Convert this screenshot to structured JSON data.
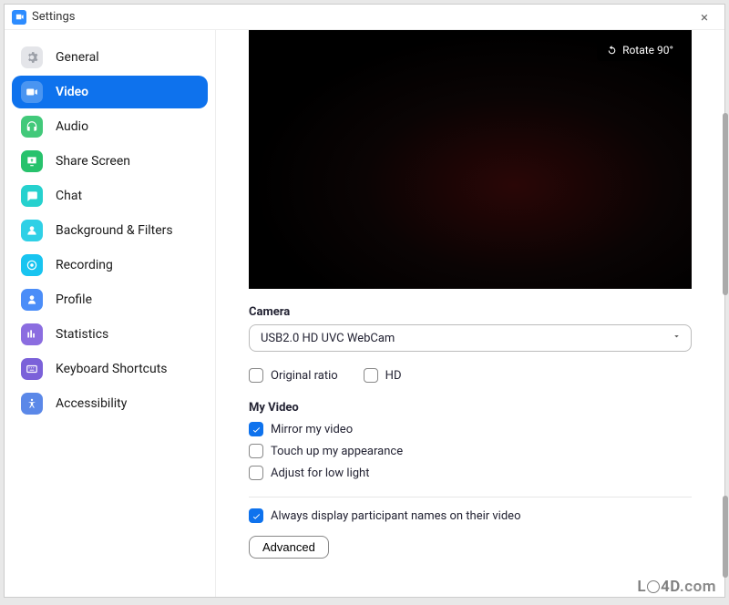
{
  "window": {
    "title": "Settings",
    "close_label": "×"
  },
  "sidebar": {
    "items": [
      {
        "label": "General",
        "icon_bg": "#E4E5E9",
        "selected": false,
        "icon": "gear"
      },
      {
        "label": "Video",
        "icon_bg": "#0E72ED",
        "selected": true,
        "icon": "video"
      },
      {
        "label": "Audio",
        "icon_bg": "#42C97A",
        "selected": false,
        "icon": "headphones"
      },
      {
        "label": "Share Screen",
        "icon_bg": "#27C26C",
        "selected": false,
        "icon": "share"
      },
      {
        "label": "Chat",
        "icon_bg": "#26D1CE",
        "selected": false,
        "icon": "chat"
      },
      {
        "label": "Background & Filters",
        "icon_bg": "#2FD0E6",
        "selected": false,
        "icon": "user"
      },
      {
        "label": "Recording",
        "icon_bg": "#18C4F0",
        "selected": false,
        "icon": "record"
      },
      {
        "label": "Profile",
        "icon_bg": "#4B8DF8",
        "selected": false,
        "icon": "profile"
      },
      {
        "label": "Statistics",
        "icon_bg": "#8B6DE0",
        "selected": false,
        "icon": "stats"
      },
      {
        "label": "Keyboard Shortcuts",
        "icon_bg": "#7B61D9",
        "selected": false,
        "icon": "keyboard"
      },
      {
        "label": "Accessibility",
        "icon_bg": "#5B88E8",
        "selected": false,
        "icon": "accessibility"
      }
    ]
  },
  "content": {
    "rotate_label": "Rotate 90°",
    "camera_heading": "Camera",
    "camera_selected": "USB2.0 HD UVC WebCam",
    "original_ratio_label": "Original ratio",
    "hd_label": "HD",
    "my_video_heading": "My Video",
    "mirror_label": "Mirror my video",
    "touch_up_label": "Touch up my appearance",
    "low_light_label": "Adjust for low light",
    "display_names_label": "Always display participant names on their video",
    "advanced_label": "Advanced",
    "checks": {
      "original_ratio": false,
      "hd": false,
      "mirror": true,
      "touch_up": false,
      "low_light": false,
      "display_names": true
    }
  },
  "watermark": "LO4D.com"
}
